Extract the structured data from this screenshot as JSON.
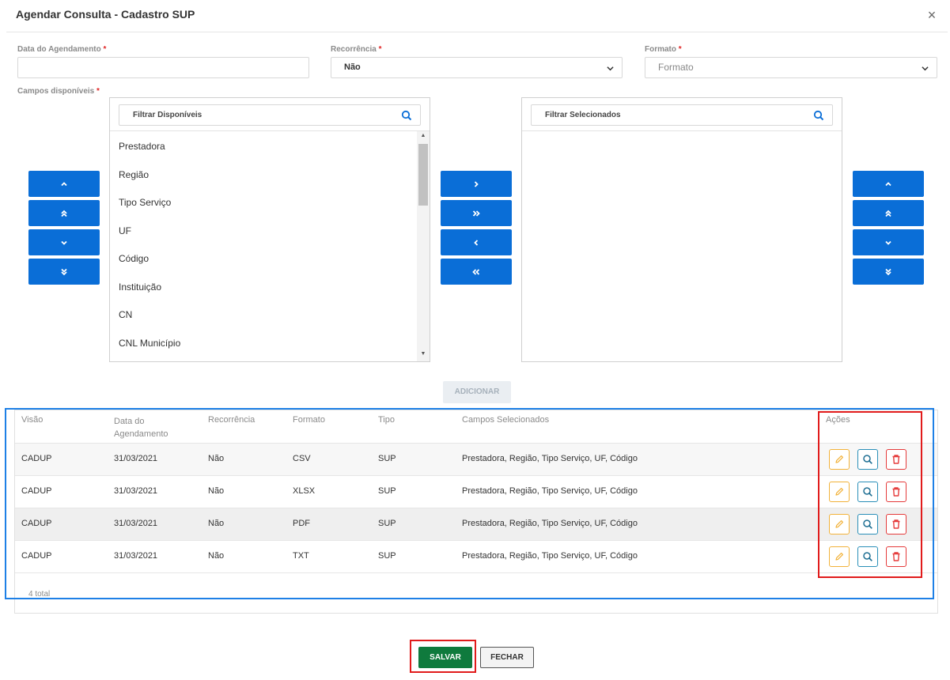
{
  "modal": {
    "title": "Agendar Consulta - Cadastro SUP",
    "close_glyph": "×"
  },
  "form": {
    "data_label": "Data do Agendamento",
    "required_mark": "*",
    "data_value": "",
    "recorrencia_label": "Recorrência",
    "recorrencia_value": "Não",
    "formato_label": "Formato",
    "formato_placeholder": "Formato",
    "campos_label": "Campos disponíveis"
  },
  "available": {
    "filter_label": "Filtrar Disponíveis",
    "items": [
      "Prestadora",
      "Região",
      "Tipo Serviço",
      "UF",
      "Código",
      "Instituição",
      "CN",
      "CNL Município"
    ],
    "scroll_fraction_visible": 0.3
  },
  "selected": {
    "filter_label": "Filtrar Selecionados",
    "items": []
  },
  "actions": {
    "add_label": "ADICIONAR"
  },
  "table": {
    "headers": {
      "visao": "Visão",
      "data": "Data do Agendamento",
      "recorrencia": "Recorrência",
      "formato": "Formato",
      "tipo": "Tipo",
      "campos": "Campos Selecionados",
      "acoes": "Ações"
    },
    "rows": [
      {
        "visao": "CADUP",
        "data": "31/03/2021",
        "recorrencia": "Não",
        "formato": "CSV",
        "tipo": "SUP",
        "campos": "Prestadora, Região, Tipo Serviço, UF, Código"
      },
      {
        "visao": "CADUP",
        "data": "31/03/2021",
        "recorrencia": "Não",
        "formato": "XLSX",
        "tipo": "SUP",
        "campos": "Prestadora, Região, Tipo Serviço, UF, Código"
      },
      {
        "visao": "CADUP",
        "data": "31/03/2021",
        "recorrencia": "Não",
        "formato": "PDF",
        "tipo": "SUP",
        "campos": "Prestadora, Região, Tipo Serviço, UF, Código"
      },
      {
        "visao": "CADUP",
        "data": "31/03/2021",
        "recorrencia": "Não",
        "formato": "TXT",
        "tipo": "SUP",
        "campos": "Prestadora, Região, Tipo Serviço, UF, Código"
      }
    ],
    "total": "4 total"
  },
  "footer": {
    "save_label": "SALVAR",
    "close_label": "FECHAR"
  },
  "colors": {
    "primary_blue": "#0a6ed7",
    "save_green": "#0f7a3d",
    "edit_yellow": "#f2b23a",
    "view_teal": "#2a8fb8",
    "delete_red": "#e53b3b",
    "highlight_red": "#e11b1b",
    "highlight_blue": "#1e80e6"
  }
}
